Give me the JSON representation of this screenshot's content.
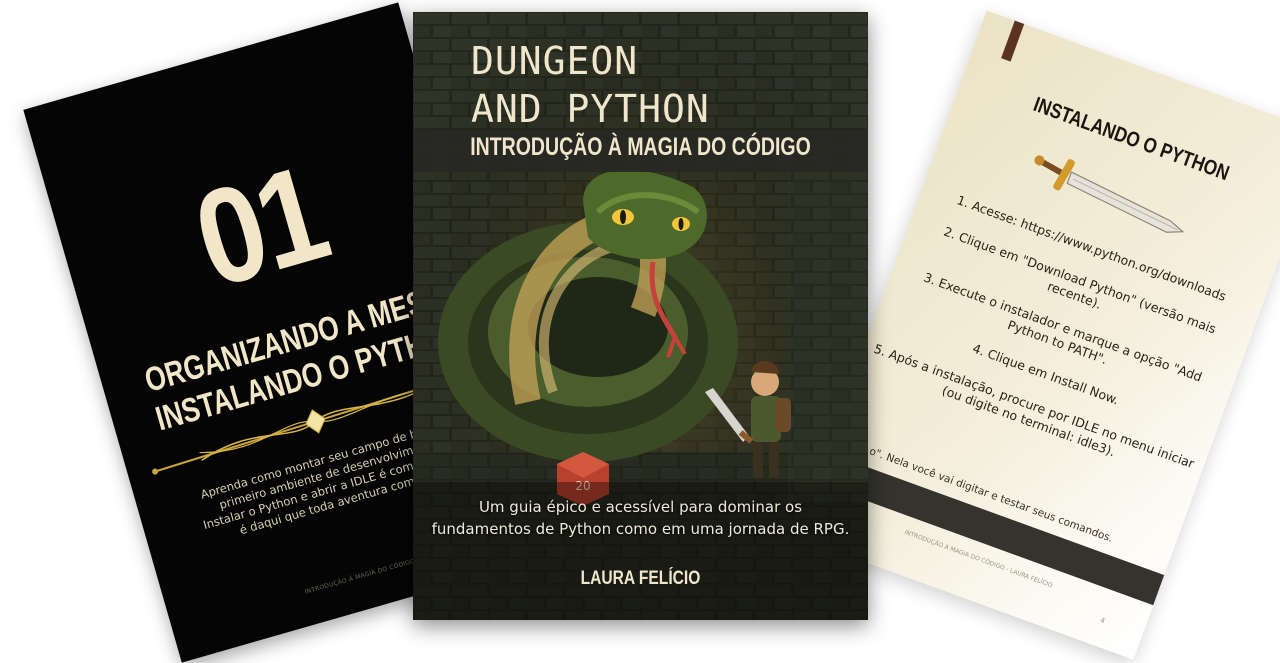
{
  "left_page": {
    "chapter_number": "01",
    "title_lines": [
      "ORGANIZANDO A MESA,",
      "INSTALANDO O PYTHON"
    ],
    "description_lines": [
      "Aprenda como montar seu campo de batalha",
      "primeiro ambiente de desenvolvimento.",
      "Instalar o Python e abrir a IDLE é como equipar",
      "é daqui que toda aventura começa."
    ],
    "footer": "INTRODUÇÃO À MAGIA DO CÓDIGO"
  },
  "cover": {
    "title_line1": "DUNGEON",
    "title_line2": "AND PYTHON",
    "subtitle": "INTRODUÇÃO À MAGIA DO CÓDIGO",
    "tagline_line1": "Um guia épico e acessível para dominar os",
    "tagline_line2": "fundamentos de Python como em uma jornada de RPG.",
    "author": "LAURA FELÍCIO"
  },
  "right_page": {
    "title": "INSTALANDO O PYTHON",
    "steps": [
      "1. Acesse: https://www.python.org/downloads",
      "2. Clique em \"Download Python\" (versão mais recente).",
      "3. Execute o instalador e marque a opção \"Add Python to PATH\".",
      "4. Clique em Install Now.",
      "5. Após a instalação, procure por IDLE no menu iniciar (ou digite no terminal: idle3)."
    ],
    "note": "o\". Nela você vai digitar e testar seus comandos.",
    "band_text": "",
    "footer": "INTRODUÇÃO À MAGIA DO CÓDIGO - LAURA FELÍCIO",
    "page_number": "4"
  }
}
